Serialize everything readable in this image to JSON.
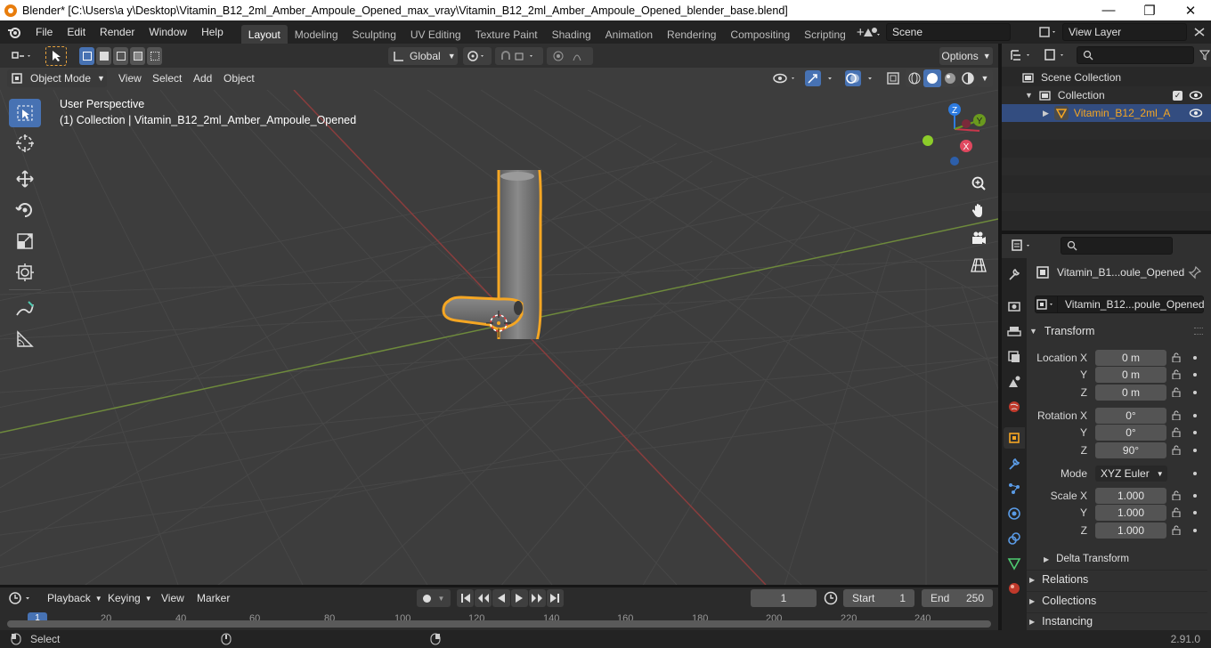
{
  "window": {
    "title": "Blender* [C:\\Users\\a y\\Desktop\\Vitamin_B12_2ml_Amber_Ampoule_Opened_max_vray\\Vitamin_B12_2ml_Amber_Ampoule_Opened_blender_base.blend]"
  },
  "menu": [
    "File",
    "Edit",
    "Render",
    "Window",
    "Help"
  ],
  "workspaces": [
    "Layout",
    "Modeling",
    "Sculpting",
    "UV Editing",
    "Texture Paint",
    "Shading",
    "Animation",
    "Rendering",
    "Compositing",
    "Scripting"
  ],
  "scene": {
    "name": "Scene",
    "view_layer": "View Layer"
  },
  "header": {
    "orientation": "Global",
    "options": "Options"
  },
  "viewport_header": {
    "mode": "Object Mode",
    "view": "View",
    "select": "Select",
    "add": "Add",
    "object": "Object"
  },
  "overlay_text": {
    "perspective": "User Perspective",
    "collection": "(1) Collection | Vitamin_B12_2ml_Amber_Ampoule_Opened"
  },
  "gizmo": {
    "x": "X",
    "y": "Y",
    "z": "Z"
  },
  "outliner": {
    "root": "Scene Collection",
    "collection": "Collection",
    "object": "Vitamin_B12_2ml_A"
  },
  "properties": {
    "object_name": "Vitamin_B1...oule_Opened",
    "object_field": "Vitamin_B12...poule_Opened",
    "transform": "Transform",
    "location_label": "Location X",
    "loc": [
      "0 m",
      "0 m",
      "0 m"
    ],
    "rotation_label": "Rotation X",
    "rot": [
      "0°",
      "0°",
      "90°"
    ],
    "y": "Y",
    "z": "Z",
    "mode_label": "Mode",
    "mode": "XYZ Euler",
    "scale_label": "Scale X",
    "scale": [
      "1.000",
      "1.000",
      "1.000"
    ],
    "delta": "Delta Transform",
    "relations": "Relations",
    "collections": "Collections",
    "instancing": "Instancing"
  },
  "timeline": {
    "playback": "Playback",
    "keying": "Keying",
    "view": "View",
    "marker": "Marker",
    "frame": "1",
    "start_label": "Start",
    "start": "1",
    "end_label": "End",
    "end": "250",
    "current": "1",
    "ticks": [
      "20",
      "40",
      "60",
      "80",
      "100",
      "120",
      "140",
      "160",
      "180",
      "200",
      "220",
      "240"
    ]
  },
  "status": {
    "select": "Select",
    "version": "2.91.0"
  }
}
